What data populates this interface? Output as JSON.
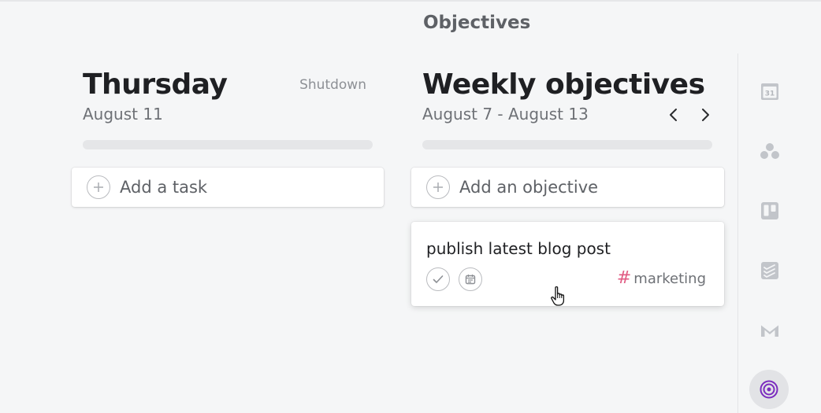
{
  "header": {
    "title": "Objectives"
  },
  "day": {
    "title": "Thursday",
    "date": "August 11",
    "shutdown_label": "Shutdown",
    "progress": 0,
    "add_label": "Add a task"
  },
  "objectives": {
    "title": "Weekly objectives",
    "date_range": "August 7 - August 13",
    "progress": 0,
    "add_label": "Add an objective",
    "items": [
      {
        "title": "publish latest blog post",
        "tag": "marketing"
      }
    ]
  },
  "colors": {
    "tag_hash": "#e15a82",
    "active_icon": "#7b2cbf"
  },
  "sidebar": {
    "icons": [
      "calendar-icon",
      "asana-icon",
      "trello-icon",
      "todoist-icon",
      "gmail-icon",
      "objectives-target-icon"
    ],
    "calendar_day": "31"
  }
}
